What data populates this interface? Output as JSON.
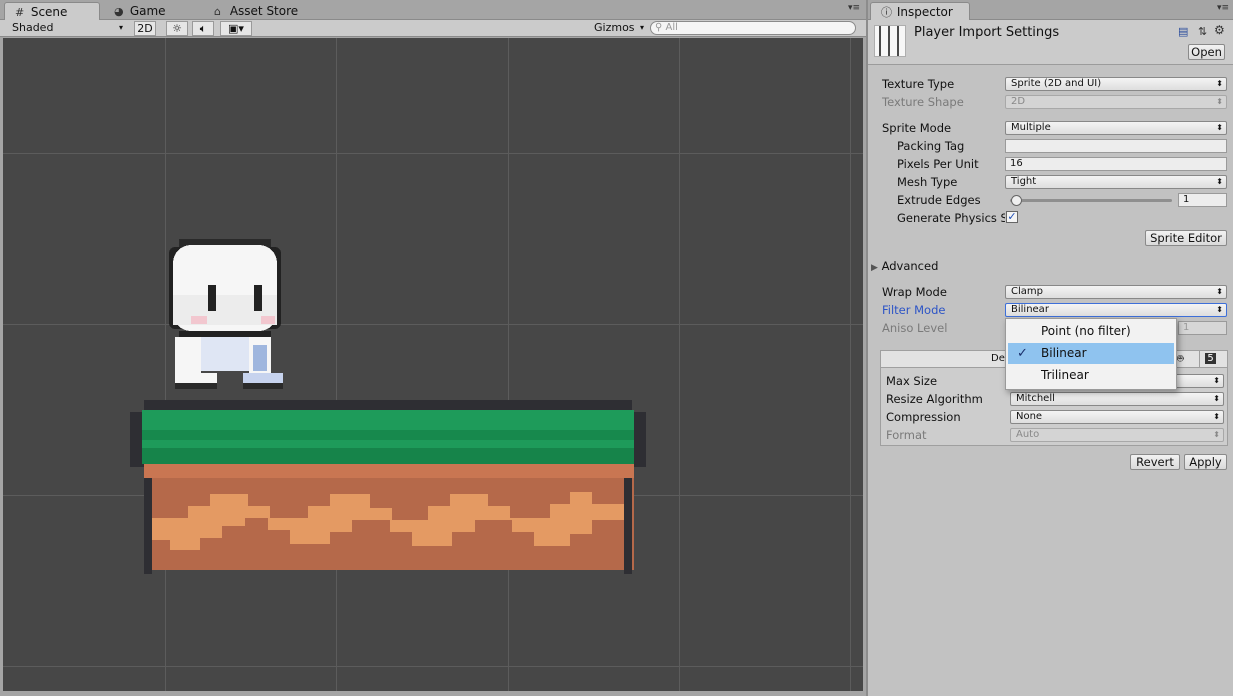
{
  "scene_panel": {
    "tabs": [
      {
        "label": "Scene",
        "icon": "grid-icon"
      },
      {
        "label": "Game",
        "icon": "pacman-icon"
      },
      {
        "label": "Asset Store",
        "icon": "store-icon"
      }
    ],
    "toolbar": {
      "shading_mode": "Shaded",
      "mode_2d": "2D",
      "gizmos": "Gizmos",
      "search_placeholder": "All"
    }
  },
  "inspector": {
    "tab_label": "Inspector",
    "asset_title": "Player Import Settings",
    "open_button": "Open",
    "fields": {
      "texture_type": {
        "label": "Texture Type",
        "value": "Sprite (2D and UI)"
      },
      "texture_shape": {
        "label": "Texture Shape",
        "value": "2D"
      },
      "sprite_mode": {
        "label": "Sprite Mode",
        "value": "Multiple"
      },
      "packing_tag": {
        "label": "Packing Tag",
        "value": ""
      },
      "pixels_per_unit": {
        "label": "Pixels Per Unit",
        "value": "16"
      },
      "mesh_type": {
        "label": "Mesh Type",
        "value": "Tight"
      },
      "extrude_edges": {
        "label": "Extrude Edges",
        "value": "1",
        "slider_fraction": 0.02
      },
      "generate_physics": {
        "label": "Generate Physics S",
        "checked": true
      },
      "sprite_editor_button": "Sprite Editor",
      "advanced": "Advanced",
      "wrap_mode": {
        "label": "Wrap Mode",
        "value": "Clamp"
      },
      "filter_mode": {
        "label": "Filter Mode",
        "value": "Bilinear"
      },
      "aniso_level": {
        "label": "Aniso Level",
        "value": "1"
      }
    },
    "platform_section": {
      "tab_label": "De",
      "max_size": {
        "label": "Max Size",
        "value": ""
      },
      "resize_algorithm": {
        "label": "Resize Algorithm",
        "value": "Mitchell"
      },
      "compression": {
        "label": "Compression",
        "value": "None"
      },
      "format": {
        "label": "Format",
        "value": "Auto"
      }
    },
    "revert_button": "Revert",
    "apply_button": "Apply"
  },
  "filter_dropdown": {
    "options": [
      "Point (no filter)",
      "Bilinear",
      "Trilinear"
    ],
    "selected": "Bilinear"
  },
  "colors": {
    "viewport_bg": "#474747",
    "grass": "#1e9b5a",
    "dirt": "#b5694a",
    "dirt_light": "#e49a63",
    "selection": "#8fc3ef",
    "label_blue": "#2c54c6"
  }
}
